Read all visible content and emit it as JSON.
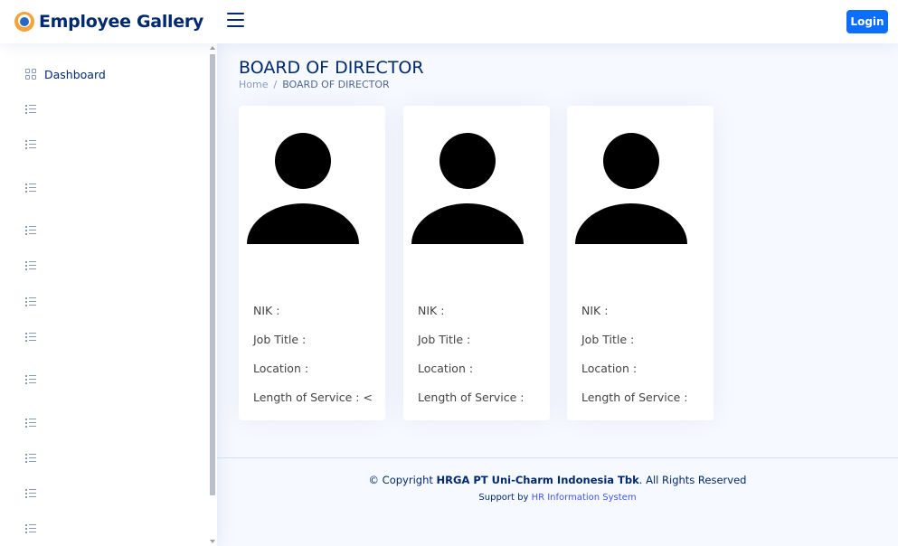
{
  "header": {
    "app_title": "Employee Gallery",
    "login_label": "Login"
  },
  "sidebar": {
    "dashboard_label": "Dashboard",
    "menu_items": [
      {
        "icon": "list-icon",
        "label": ""
      },
      {
        "icon": "list-icon",
        "label": ""
      },
      {
        "icon": "list-icon",
        "label": ""
      },
      {
        "icon": "list-icon",
        "label": ""
      },
      {
        "icon": "list-icon",
        "label": ""
      },
      {
        "icon": "list-icon",
        "label": ""
      },
      {
        "icon": "list-icon",
        "label": ""
      },
      {
        "icon": "list-icon",
        "label": ""
      },
      {
        "icon": "list-icon",
        "label": ""
      },
      {
        "icon": "list-icon",
        "label": ""
      },
      {
        "icon": "list-icon",
        "label": ""
      },
      {
        "icon": "list-icon",
        "label": ""
      }
    ]
  },
  "main": {
    "page_title": "BOARD OF DIRECTOR",
    "breadcrumb": {
      "home": "Home",
      "separator": "/",
      "current": "BOARD OF DIRECTOR"
    },
    "cards": [
      {
        "nik": "NIK :",
        "job_title": "Job Title :",
        "location": "Location :",
        "length_of_service": "Length of Service : <"
      },
      {
        "nik": "NIK :",
        "job_title": "Job Title :",
        "location": "Location :",
        "length_of_service": "Length of Service :"
      },
      {
        "nik": "NIK :",
        "job_title": "Job Title :",
        "location": "Location :",
        "length_of_service": "Length of Service :"
      }
    ]
  },
  "footer": {
    "copyright_prefix": "© Copyright ",
    "company": "HRGA PT Uni-Charm Indonesia Tbk",
    "copyright_suffix": ". All Rights Reserved",
    "support_prefix": "Support by ",
    "support_link": "HR Information System"
  },
  "colors": {
    "brand": "#012970",
    "accent": "#0d6efd",
    "background": "#f6f9ff"
  }
}
